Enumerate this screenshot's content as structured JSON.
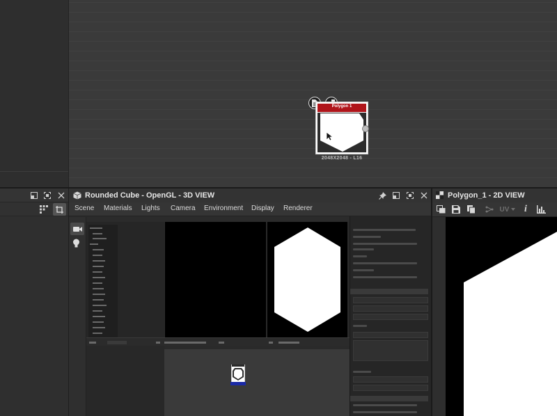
{
  "graph": {
    "node": {
      "title": "Polygon 1",
      "caption": "2048X2048 - L16"
    }
  },
  "view3d": {
    "title": "Rounded Cube - OpenGL - 3D VIEW",
    "menu": [
      "Scene",
      "Materials",
      "Lights",
      "Camera",
      "Environment",
      "Display",
      "Renderer"
    ]
  },
  "view2d": {
    "title": "Polygon_1 - 2D VIEW",
    "uv_label": "UV"
  },
  "colors": {
    "node_header": "#b0141a",
    "panel_bg": "#2b2b2b",
    "graph_bg": "#3a3a3a",
    "selection_blue": "#1b2aa6"
  },
  "icons": [
    "expand-icon",
    "maximize-icon",
    "close-icon",
    "pin-icon",
    "cube-icon",
    "camera-icon",
    "light-icon",
    "grid-icon",
    "frame-icon",
    "document-icon",
    "checker-icon",
    "save-icon",
    "copy-icon",
    "nodes-icon",
    "info-icon",
    "histogram-icon"
  ]
}
